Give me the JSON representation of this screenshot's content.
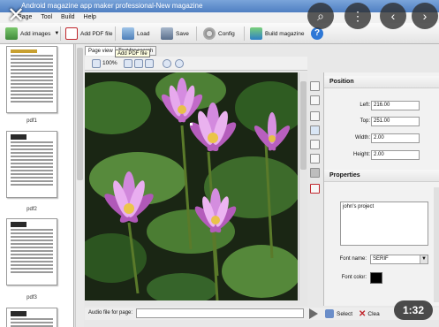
{
  "window": {
    "title": "Android magazine app maker professional-New magazine"
  },
  "menu": [
    "Page",
    "Tool",
    "Build",
    "Help"
  ],
  "toolbar": {
    "add_images": "Add images",
    "add_pdf": "Add PDF file",
    "load": "Load",
    "save": "Save",
    "config": "Config",
    "build": "Build magazine"
  },
  "thumbnails": {
    "labels": [
      "pdf1",
      "pdf2",
      "pdf3"
    ]
  },
  "tabs": [
    "Page view",
    "Text for search"
  ],
  "view": {
    "zoom": "100%"
  },
  "position": {
    "title": "Position",
    "left_label": "Left:",
    "left_value": "216.00",
    "top_label": "Top:",
    "top_value": "251.00",
    "width_label": "Width:",
    "width_value": "2.00",
    "height_label": "Height:",
    "height_value": "2.00"
  },
  "properties": {
    "title": "Properties",
    "text_value": "john's project",
    "font_label": "Font name:",
    "font_value": "SERIF",
    "color_label": "Font color:",
    "color_value": "#000000"
  },
  "audio": {
    "label": "Audio file for page:",
    "select_label": "Select",
    "clear_label": "Clea"
  },
  "overlay": {
    "time": "1:32",
    "tooltip": "Add PDF file"
  }
}
